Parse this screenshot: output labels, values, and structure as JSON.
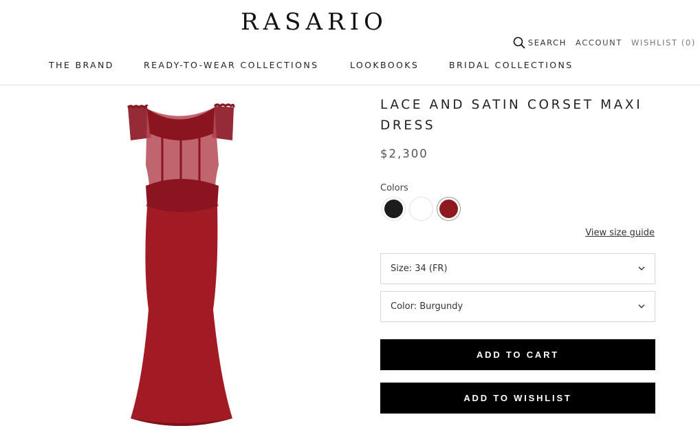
{
  "header": {
    "logo": "RASARIO",
    "search_label": "SEARCH",
    "account_label": "ACCOUNT",
    "wishlist_label": "WISHLIST (0)"
  },
  "nav": {
    "items": [
      "THE BRAND",
      "READY-TO-WEAR COLLECTIONS",
      "LOOKBOOKS",
      "BRIDAL COLLECTIONS"
    ]
  },
  "product": {
    "title": "LACE AND SATIN CORSET MAXI DRESS",
    "price": "$2,300",
    "colors_label": "Colors",
    "swatches": [
      {
        "name": "black",
        "color": "#1c1c1c",
        "selected": false
      },
      {
        "name": "white",
        "color": "#ffffff",
        "selected": false
      },
      {
        "name": "burgundy",
        "color": "#8e1a1f",
        "selected": true
      }
    ],
    "size_guide_label": "View size guide",
    "size_select": "Size: 34 (FR)",
    "color_select": "Color: Burgundy",
    "add_to_cart": "ADD TO CART",
    "add_to_wishlist": "ADD TO WISHLIST",
    "dress_color": "#a11a24",
    "lace_color": "#8a1420"
  }
}
